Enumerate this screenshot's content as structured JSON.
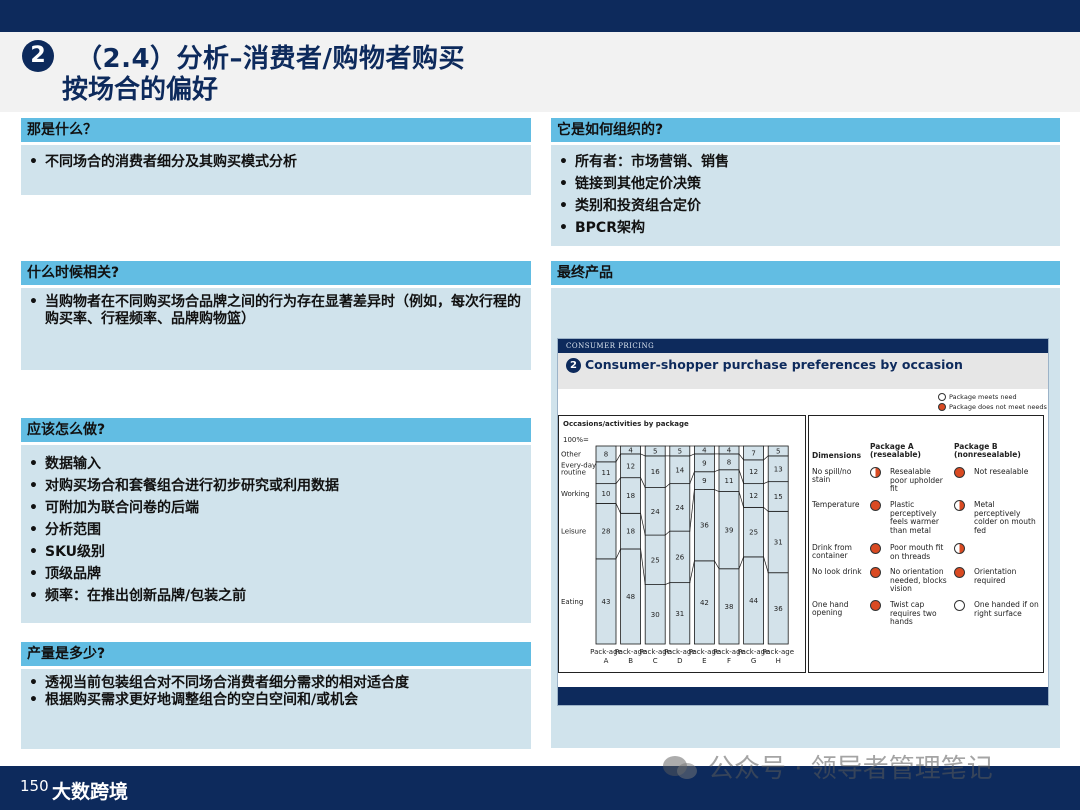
{
  "title": {
    "number": "2",
    "line1": "（2.4）分析–消费者/购物者购买",
    "line2": "按场合的偏好"
  },
  "sections": {
    "what": {
      "heading": "那是什么？",
      "items": [
        "不同场合的消费者细分及其购买模式分析"
      ]
    },
    "how_organized": {
      "heading": "它是如何组织的?",
      "items": [
        "所有者：市场营销、销售",
        "链接到其他定价决策",
        "类别和投资组合定价",
        "BPCR架构"
      ]
    },
    "when": {
      "heading": "什么时候相关?",
      "items": [
        "当购物者在不同购买场合品牌之间的行为存在显著差异时（例如，每次行程的购买率、行程频率、品牌购物篮）"
      ]
    },
    "final_product": {
      "heading": "最终产品"
    },
    "what_to_do": {
      "heading": "应该怎么做?",
      "items": [
        "数据输入",
        "对购买场合和套餐组合进行初步研究或利用数据",
        "可附加为联合问卷的后端",
        "分析范围",
        "SKU级别",
        "顶级品牌",
        "频率：在推出创新品牌/包装之前"
      ]
    },
    "output": {
      "heading": "产量是多少?",
      "items": [
        "透视当前包装组合对不同场合消费者细分需求的相对适合度",
        "根据购买需求更好地调整组合的空白空间和/或机会"
      ]
    }
  },
  "figure": {
    "header_label": "CONSUMER PRICING",
    "number": "2",
    "title": "Consumer-shopper purchase preferences by occasion",
    "legend": [
      {
        "symbol": "empty-circle",
        "label": "Package meets need"
      },
      {
        "symbol": "full-circle",
        "label": "Package does not meet needs"
      }
    ]
  },
  "chart_data": {
    "type": "bar",
    "stacked": true,
    "title": "Occasions/activities by package",
    "ylabel": "100%=",
    "categories": [
      "Pack-age A",
      "Pack-age B",
      "Pack-age C",
      "Pack-age D",
      "Pack-age E",
      "Pack-age F",
      "Pack-age G",
      "Pack-age H"
    ],
    "series": [
      {
        "name": "Eating",
        "values": [
          43,
          48,
          30,
          31,
          42,
          38,
          44,
          36
        ]
      },
      {
        "name": "Leisure",
        "values": [
          28,
          18,
          25,
          26,
          36,
          39,
          25,
          31
        ]
      },
      {
        "name": "Working",
        "values": [
          10,
          18,
          24,
          24,
          9,
          11,
          12,
          15
        ]
      },
      {
        "name": "Every-day routine",
        "values": [
          11,
          12,
          16,
          14,
          9,
          8,
          12,
          13
        ]
      },
      {
        "name": "Other",
        "values": [
          8,
          4,
          5,
          5,
          4,
          4,
          7,
          5
        ]
      }
    ],
    "colors": {
      "fill": "#d3e2ea",
      "stroke": "#1a1a1a"
    }
  },
  "dimensions_table": {
    "headers": [
      "Dimensions",
      "Package A (resealable)",
      "Package B (nonresealable)"
    ],
    "rows": [
      {
        "dimension": "No spill/no stain",
        "a_rating": "half",
        "a_text": "Resealable poor upholder fit",
        "b_rating": "full",
        "b_text": "Not resealable"
      },
      {
        "dimension": "Temperature",
        "a_rating": "full",
        "a_text": "Plastic perceptively feels warmer than metal",
        "b_rating": "half",
        "b_text": "Metal perceptively colder on mouth fed"
      },
      {
        "dimension": "Drink from container",
        "a_rating": "full",
        "a_text": "Poor mouth fit on threads",
        "b_rating": "half",
        "b_text": ""
      },
      {
        "dimension": "No look drink",
        "a_rating": "full",
        "a_text": "No orientation needed, blocks vision",
        "b_rating": "full",
        "b_text": "Orientation required"
      },
      {
        "dimension": "One hand opening",
        "a_rating": "full",
        "a_text": "Twist cap requires two hands",
        "b_rating": "empty",
        "b_text": "One handed if on right surface"
      }
    ]
  },
  "footer": {
    "page_number": "150",
    "brand": "大数跨境",
    "watermark": "公众号 · 领导者管理笔记"
  }
}
